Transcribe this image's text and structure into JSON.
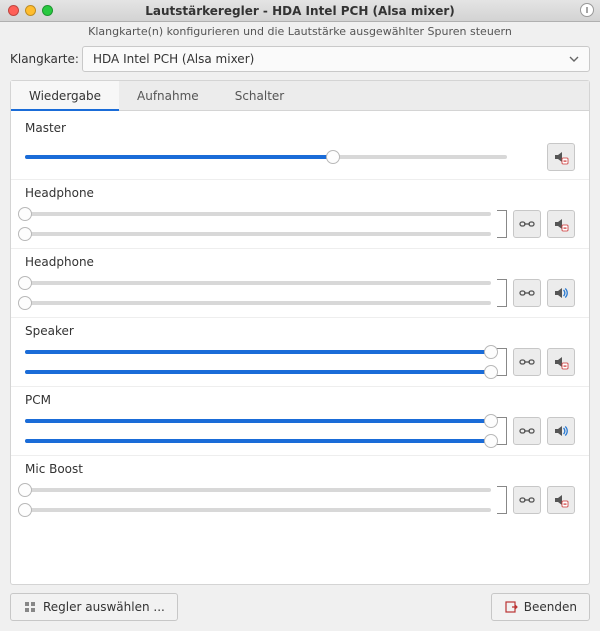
{
  "window": {
    "title": "Lautstärkeregler - HDA Intel PCH (Alsa mixer)",
    "subtitle": "Klangkarte(n) konfigurieren und die Lautstärke ausgewählter Spuren steuern"
  },
  "soundcard": {
    "label": "Klangkarte:",
    "selected": "HDA Intel PCH (Alsa mixer)"
  },
  "tabs": [
    {
      "label": "Wiedergabe",
      "active": true
    },
    {
      "label": "Aufnahme",
      "active": false
    },
    {
      "label": "Schalter",
      "active": false
    }
  ],
  "channels": [
    {
      "name": "Master",
      "stereo": false,
      "levels": [
        64
      ],
      "link": false,
      "mute": "muted"
    },
    {
      "name": "Headphone",
      "stereo": true,
      "levels": [
        0,
        0
      ],
      "link": true,
      "mute": "muted"
    },
    {
      "name": "Headphone",
      "stereo": true,
      "levels": [
        0,
        0
      ],
      "link": true,
      "mute": "on"
    },
    {
      "name": "Speaker",
      "stereo": true,
      "levels": [
        100,
        100
      ],
      "link": true,
      "mute": "muted"
    },
    {
      "name": "PCM",
      "stereo": true,
      "levels": [
        100,
        100
      ],
      "link": true,
      "mute": "on"
    },
    {
      "name": "Mic Boost",
      "stereo": true,
      "levels": [
        0,
        0
      ],
      "link": true,
      "mute": "muted"
    }
  ],
  "footer": {
    "select_controls_label": "Regler auswählen ...",
    "quit_label": "Beenden"
  }
}
